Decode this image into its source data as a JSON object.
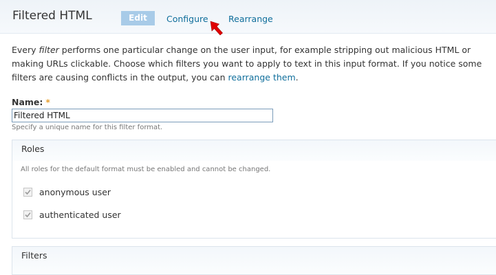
{
  "header": {
    "title": "Filtered HTML",
    "tabs": [
      {
        "label": "Edit",
        "active": true
      },
      {
        "label": "Configure",
        "active": false
      },
      {
        "label": "Rearrange",
        "active": false
      }
    ]
  },
  "intro": {
    "part1": "Every ",
    "emphasis": "filter",
    "part2": " performs one particular change on the user input, for example stripping out malicious HTML or making URLs clickable. Choose which filters you want to apply to text in this input format. If you notice some filters are causing conflicts in the output, you can ",
    "link": "rearrange them",
    "part3": "."
  },
  "name_field": {
    "label": "Name:",
    "required_marker": "*",
    "value": "Filtered HTML",
    "description": "Specify a unique name for this filter format."
  },
  "roles": {
    "legend": "Roles",
    "description": "All roles for the default format must be enabled and cannot be changed.",
    "items": [
      {
        "label": "anonymous user",
        "checked": true,
        "disabled": true
      },
      {
        "label": "authenticated user",
        "checked": true,
        "disabled": true
      }
    ]
  },
  "filters": {
    "legend": "Filters"
  },
  "colors": {
    "link": "#0f6e9b",
    "active_tab": "#a8cbe8",
    "required": "#e8a030",
    "pointer": "#e00000"
  }
}
